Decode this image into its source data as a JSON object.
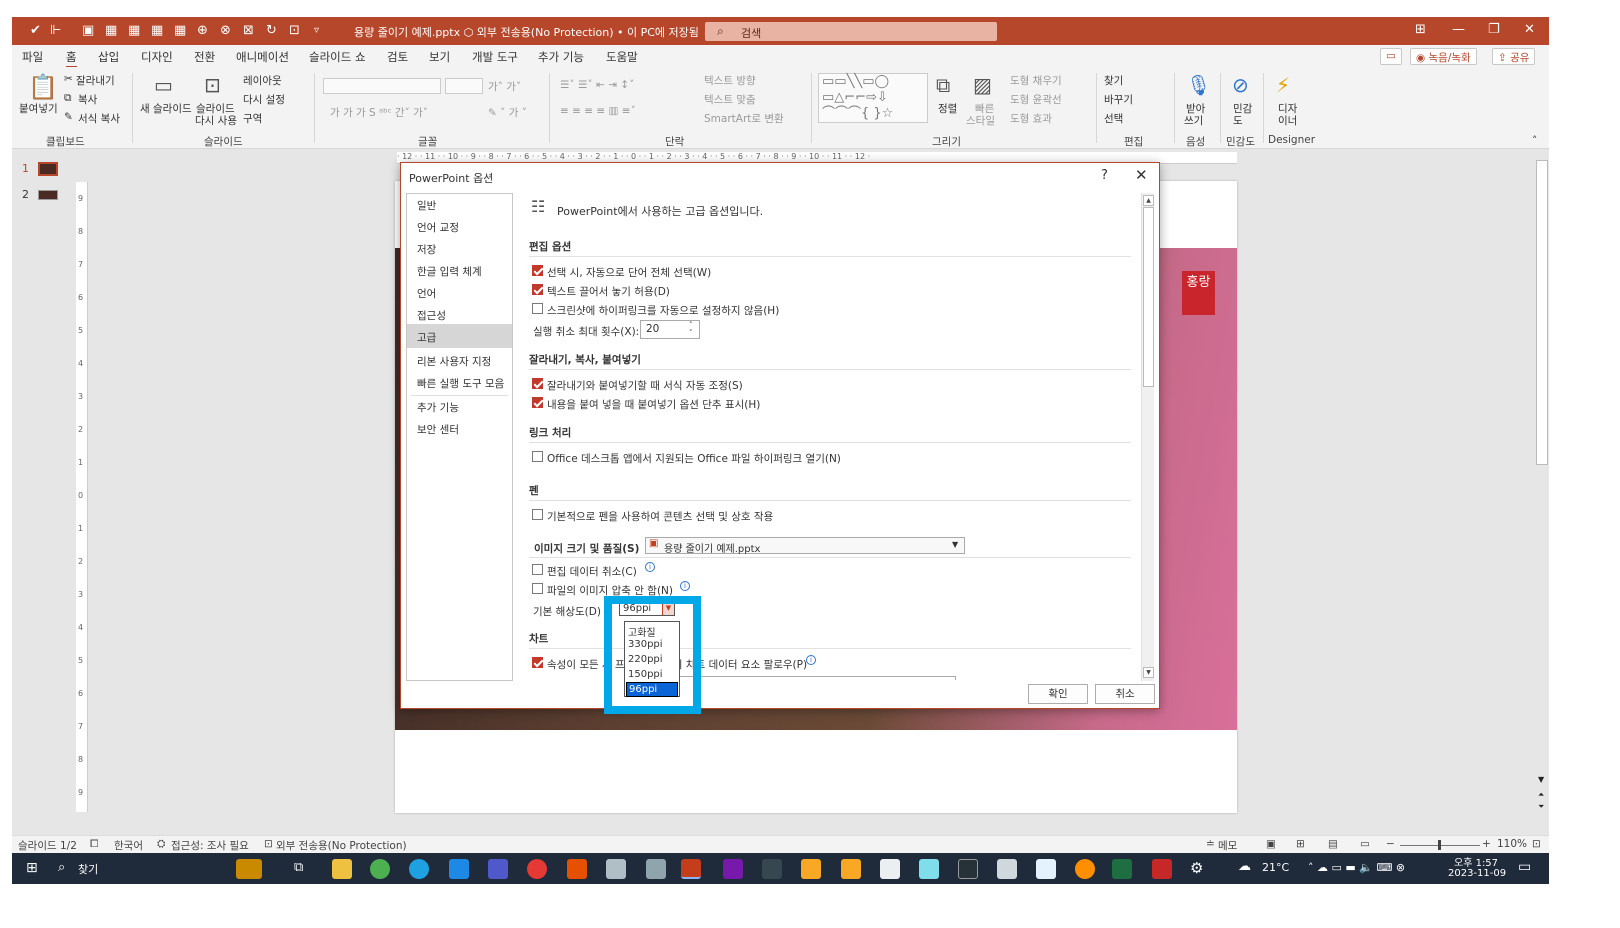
{
  "titlebar": {
    "doc_title": "용량 줄이기 예제.pptx  ⬡ 외부 전송용(No Protection) • 이 PC에 저장됨 ⌄",
    "search_placeholder": "검색"
  },
  "menu": {
    "items": [
      "파일",
      "홈",
      "삽입",
      "디자인",
      "전환",
      "애니메이션",
      "슬라이드 쇼",
      "검토",
      "보기",
      "개발 도구",
      "추가 기능",
      "도움말"
    ],
    "record_label": "◉ 녹음/녹화",
    "share_label": "⇪ 공유"
  },
  "ribbon": {
    "paste": "붙여넣기",
    "cut": "잘라내기",
    "copy": "복사",
    "format_copy": "서식 복사",
    "clipboard_group": "클립보드",
    "new_slide": "새 슬라이드",
    "reuse_slide_1": "슬라이드",
    "reuse_slide_2": "다시 사용",
    "layout": "레이아웃",
    "reset": "다시 설정",
    "section": "구역",
    "slide_group": "슬라이드",
    "font_group": "글꼴",
    "text_direction": "텍스트 방향",
    "text_align": "텍스트 맞춤",
    "smartart": "SmartArt로 변환",
    "paragraph_group": "단락",
    "arrange": "정렬",
    "quick_style_1": "빠른",
    "quick_style_2": "스타일",
    "shape_fill": "도형 채우기",
    "shape_outline": "도형 윤곽선",
    "shape_effect": "도형 효과",
    "drawing_group": "그리기",
    "find": "찾기",
    "replace": "바꾸기",
    "select": "선택",
    "editing_group": "편집",
    "dictate_1": "받아",
    "dictate_2": "쓰기",
    "voice_group": "음성",
    "sensitivity_1": "민감",
    "sensitivity_2": "도",
    "sensitivity_group": "민감도",
    "designer_1": "디자",
    "designer_2": "이너",
    "designer_group": "Designer"
  },
  "thumbs": {
    "n1": "1",
    "n2": "2"
  },
  "ruler": {
    "h": "· 12 · · 11 · · 10 · · 9 · · 8 · · 7 · · 6 · · 5 · · 4 · · 3 · · 2 · · 1 · · 0 · · 1 · · 2 · · 3 · · 4 · · 5 · · 6 · · 7 · · 8 · · 9 · · 10 · · 11 · · 12 ·",
    "v": [
      "9",
      "8",
      "7",
      "6",
      "5",
      "4",
      "3",
      "2",
      "1",
      "0",
      "1",
      "2",
      "3",
      "4",
      "5",
      "6",
      "7",
      "8",
      "9"
    ]
  },
  "slide": {
    "seal_text": "홍랑"
  },
  "dialog": {
    "title": "PowerPoint 옵션",
    "help": "?",
    "close": "✕",
    "nav": [
      "일반",
      "언어 교정",
      "저장",
      "한글 입력 체계",
      "언어",
      "접근성",
      "고급",
      "리본 사용자 지정",
      "빠른 실행 도구 모음",
      "추가 기능",
      "보안 센터"
    ],
    "header": "PowerPoint에서 사용하는 고급 옵션입니다.",
    "edit_section": "편집 옵션",
    "opt_select_word": "선택 시, 자동으로 단어 전체 선택(W)",
    "opt_drag_drop": "텍스트 끌어서 놓기 허용(D)",
    "opt_no_hyperlink": "스크린샷에 하이퍼링크를 자동으로 설정하지 않음(H)",
    "undo_label": "실행 취소 최대 횟수(X):",
    "undo_value": "20",
    "cut_section": "잘라내기, 복사, 붙여넣기",
    "opt_smart_cut": "잘라내기와 붙여넣기할 때 서식 자동 조정(S)",
    "opt_paste_btn": "내용을 붙여 넣을 때 붙여넣기 옵션 단추 표시(H)",
    "link_section": "링크 처리",
    "opt_office_link": "Office 데스크톱 앱에서 지원되는 Office 파일 하이퍼링크 열기(N)",
    "pen_section": "펜",
    "opt_pen": "기본적으로 펜을 사용하여 콘텐츠 선택 및 상호 작용",
    "image_section": "이미지 크기 및 품질(S)",
    "image_file": "용량 줄이기 예제.pptx",
    "opt_discard_edit": "편집 데이터 취소(C)",
    "opt_no_compress": "파일의 이미지 압축 안 함(N)",
    "resolution_label": "기본 해상도(D)",
    "resolution_value": "96ppi",
    "chart_section": "차트",
    "opt_chart_follow": "속성이 모든 새 프레젠테이션의 차트 데이터 요소 팔로우(P)",
    "ok": "확인",
    "cancel": "취소"
  },
  "dropdown": {
    "options": [
      "고화질",
      "330ppi",
      "220ppi",
      "150ppi",
      "96ppi"
    ]
  },
  "status": {
    "slide": "슬라이드 1/2",
    "lang": "한국어",
    "accessibility": "접근성: 조사 필요",
    "protection": "외부 전송용(No Protection)",
    "memo": "메모",
    "zoom": "110%"
  },
  "taskbar": {
    "search": "찾기",
    "weather": "21°C",
    "time": "오후 1:57",
    "date": "2023-11-09"
  },
  "colors": {
    "accent": "#b7472a",
    "highlight": "#00a8e8",
    "select_blue": "#0a64d6"
  }
}
